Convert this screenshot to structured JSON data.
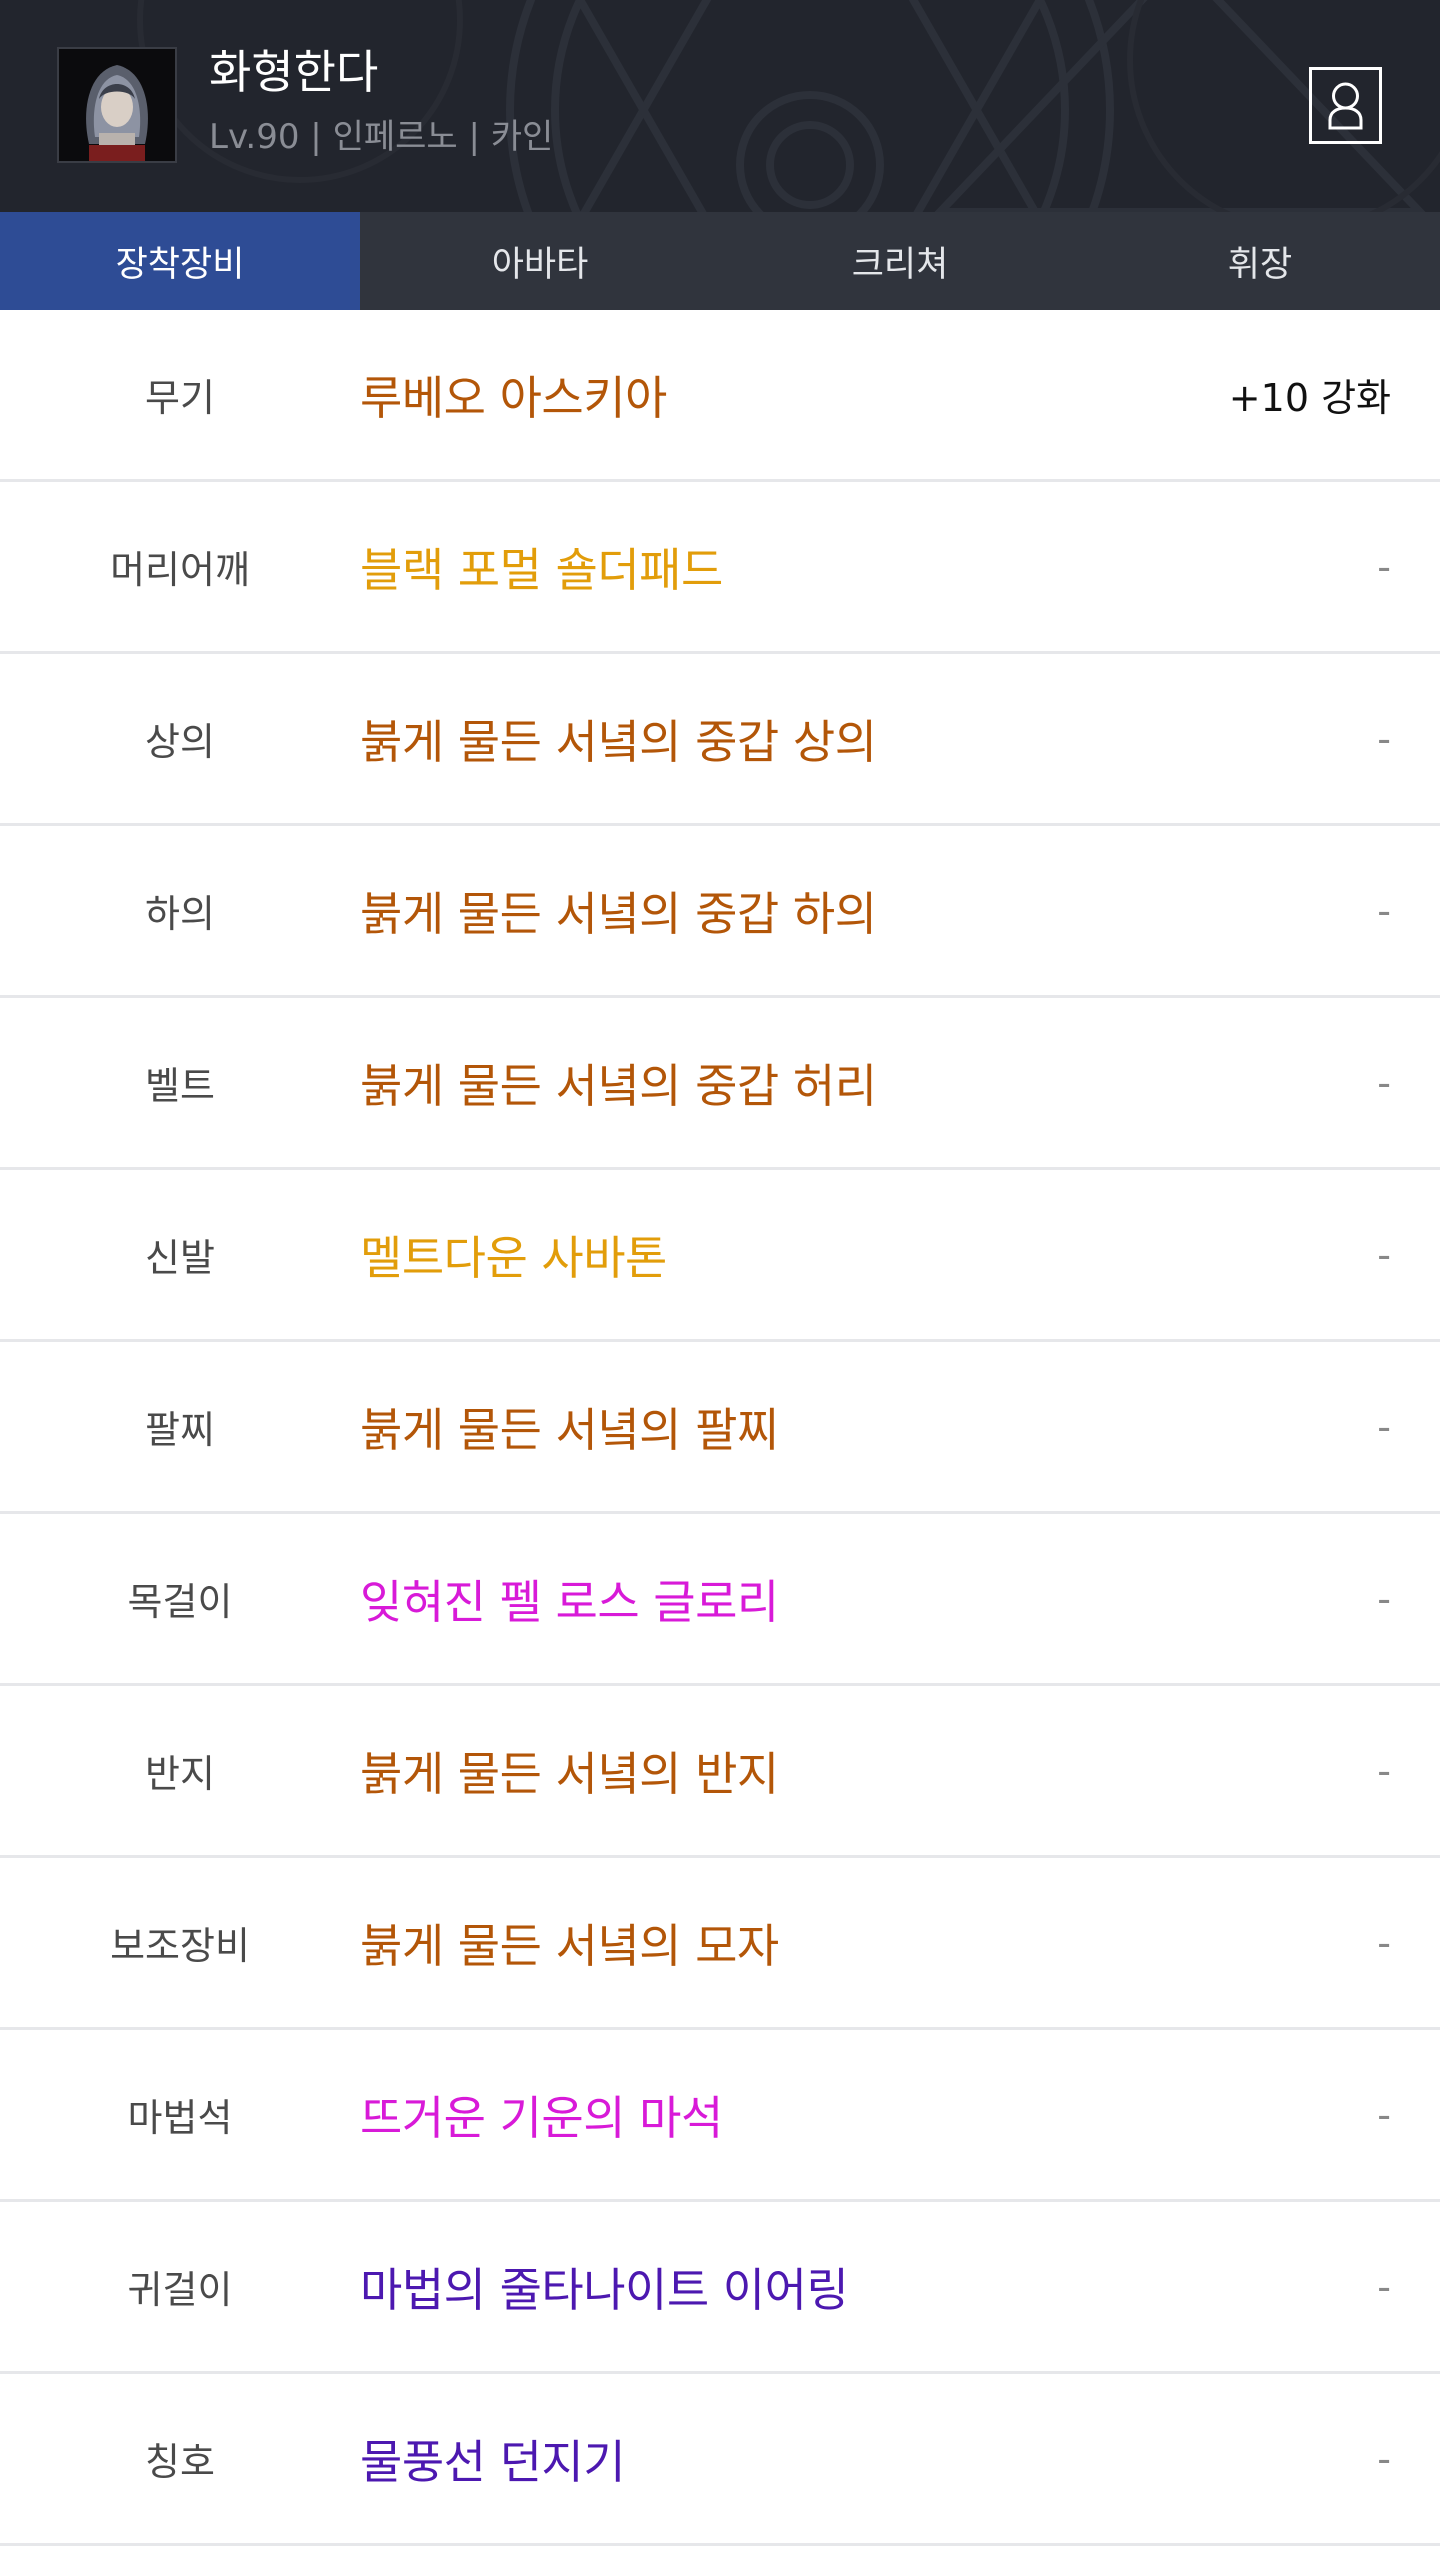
{
  "header": {
    "character_name": "화형한다",
    "character_info": "Lv.90 | 인페르노 | 카인",
    "avatar_icon": "character-portrait",
    "profile_icon": "person-icon"
  },
  "tabs": [
    {
      "label": "장착장비",
      "active": true
    },
    {
      "label": "아바타",
      "active": false
    },
    {
      "label": "크리쳐",
      "active": false
    },
    {
      "label": "휘장",
      "active": false
    }
  ],
  "colors": {
    "unique": "#b35608",
    "legendary": "#e29d0a",
    "rare": "#d81ad8",
    "epic_purple": "#4c18b0",
    "active_tab": "#2e4c95"
  },
  "equipment": [
    {
      "slot": "무기",
      "item": "루베오 아스키아",
      "enhance": "+10 강화",
      "color": "#b35608"
    },
    {
      "slot": "머리어깨",
      "item": "블랙 포멀 숄더패드",
      "enhance": "-",
      "color": "#e29d0a"
    },
    {
      "slot": "상의",
      "item": "붉게 물든 서녘의 중갑 상의",
      "enhance": "-",
      "color": "#b35608"
    },
    {
      "slot": "하의",
      "item": "붉게 물든 서녘의 중갑 하의",
      "enhance": "-",
      "color": "#b35608"
    },
    {
      "slot": "벨트",
      "item": "붉게 물든 서녘의 중갑 허리",
      "enhance": "-",
      "color": "#b35608"
    },
    {
      "slot": "신발",
      "item": "멜트다운 사바톤",
      "enhance": "-",
      "color": "#e29d0a"
    },
    {
      "slot": "팔찌",
      "item": "붉게 물든 서녘의 팔찌",
      "enhance": "-",
      "color": "#b35608"
    },
    {
      "slot": "목걸이",
      "item": "잊혀진 펠 로스 글로리",
      "enhance": "-",
      "color": "#d81ad8"
    },
    {
      "slot": "반지",
      "item": "붉게 물든 서녘의 반지",
      "enhance": "-",
      "color": "#b35608"
    },
    {
      "slot": "보조장비",
      "item": "붉게 물든 서녘의 모자",
      "enhance": "-",
      "color": "#b35608"
    },
    {
      "slot": "마법석",
      "item": "뜨거운 기운의 마석",
      "enhance": "-",
      "color": "#d81ad8"
    },
    {
      "slot": "귀걸이",
      "item": "마법의 줄타나이트 이어링",
      "enhance": "-",
      "color": "#4c18b0"
    },
    {
      "slot": "칭호",
      "item": "물풍선 던지기",
      "enhance": "-",
      "color": "#4c18b0"
    }
  ]
}
